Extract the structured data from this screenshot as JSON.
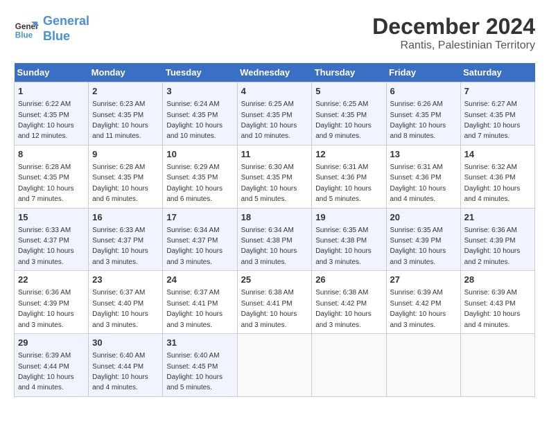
{
  "header": {
    "logo_line1": "General",
    "logo_line2": "Blue",
    "month_year": "December 2024",
    "location": "Rantis, Palestinian Territory"
  },
  "days_of_week": [
    "Sunday",
    "Monday",
    "Tuesday",
    "Wednesday",
    "Thursday",
    "Friday",
    "Saturday"
  ],
  "weeks": [
    [
      {
        "day": "1",
        "info": "Sunrise: 6:22 AM\nSunset: 4:35 PM\nDaylight: 10 hours and 12 minutes."
      },
      {
        "day": "2",
        "info": "Sunrise: 6:23 AM\nSunset: 4:35 PM\nDaylight: 10 hours and 11 minutes."
      },
      {
        "day": "3",
        "info": "Sunrise: 6:24 AM\nSunset: 4:35 PM\nDaylight: 10 hours and 10 minutes."
      },
      {
        "day": "4",
        "info": "Sunrise: 6:25 AM\nSunset: 4:35 PM\nDaylight: 10 hours and 10 minutes."
      },
      {
        "day": "5",
        "info": "Sunrise: 6:25 AM\nSunset: 4:35 PM\nDaylight: 10 hours and 9 minutes."
      },
      {
        "day": "6",
        "info": "Sunrise: 6:26 AM\nSunset: 4:35 PM\nDaylight: 10 hours and 8 minutes."
      },
      {
        "day": "7",
        "info": "Sunrise: 6:27 AM\nSunset: 4:35 PM\nDaylight: 10 hours and 7 minutes."
      }
    ],
    [
      {
        "day": "8",
        "info": "Sunrise: 6:28 AM\nSunset: 4:35 PM\nDaylight: 10 hours and 7 minutes."
      },
      {
        "day": "9",
        "info": "Sunrise: 6:28 AM\nSunset: 4:35 PM\nDaylight: 10 hours and 6 minutes."
      },
      {
        "day": "10",
        "info": "Sunrise: 6:29 AM\nSunset: 4:35 PM\nDaylight: 10 hours and 6 minutes."
      },
      {
        "day": "11",
        "info": "Sunrise: 6:30 AM\nSunset: 4:35 PM\nDaylight: 10 hours and 5 minutes."
      },
      {
        "day": "12",
        "info": "Sunrise: 6:31 AM\nSunset: 4:36 PM\nDaylight: 10 hours and 5 minutes."
      },
      {
        "day": "13",
        "info": "Sunrise: 6:31 AM\nSunset: 4:36 PM\nDaylight: 10 hours and 4 minutes."
      },
      {
        "day": "14",
        "info": "Sunrise: 6:32 AM\nSunset: 4:36 PM\nDaylight: 10 hours and 4 minutes."
      }
    ],
    [
      {
        "day": "15",
        "info": "Sunrise: 6:33 AM\nSunset: 4:37 PM\nDaylight: 10 hours and 3 minutes."
      },
      {
        "day": "16",
        "info": "Sunrise: 6:33 AM\nSunset: 4:37 PM\nDaylight: 10 hours and 3 minutes."
      },
      {
        "day": "17",
        "info": "Sunrise: 6:34 AM\nSunset: 4:37 PM\nDaylight: 10 hours and 3 minutes."
      },
      {
        "day": "18",
        "info": "Sunrise: 6:34 AM\nSunset: 4:38 PM\nDaylight: 10 hours and 3 minutes."
      },
      {
        "day": "19",
        "info": "Sunrise: 6:35 AM\nSunset: 4:38 PM\nDaylight: 10 hours and 3 minutes."
      },
      {
        "day": "20",
        "info": "Sunrise: 6:35 AM\nSunset: 4:39 PM\nDaylight: 10 hours and 3 minutes."
      },
      {
        "day": "21",
        "info": "Sunrise: 6:36 AM\nSunset: 4:39 PM\nDaylight: 10 hours and 2 minutes."
      }
    ],
    [
      {
        "day": "22",
        "info": "Sunrise: 6:36 AM\nSunset: 4:39 PM\nDaylight: 10 hours and 3 minutes."
      },
      {
        "day": "23",
        "info": "Sunrise: 6:37 AM\nSunset: 4:40 PM\nDaylight: 10 hours and 3 minutes."
      },
      {
        "day": "24",
        "info": "Sunrise: 6:37 AM\nSunset: 4:41 PM\nDaylight: 10 hours and 3 minutes."
      },
      {
        "day": "25",
        "info": "Sunrise: 6:38 AM\nSunset: 4:41 PM\nDaylight: 10 hours and 3 minutes."
      },
      {
        "day": "26",
        "info": "Sunrise: 6:38 AM\nSunset: 4:42 PM\nDaylight: 10 hours and 3 minutes."
      },
      {
        "day": "27",
        "info": "Sunrise: 6:39 AM\nSunset: 4:42 PM\nDaylight: 10 hours and 3 minutes."
      },
      {
        "day": "28",
        "info": "Sunrise: 6:39 AM\nSunset: 4:43 PM\nDaylight: 10 hours and 4 minutes."
      }
    ],
    [
      {
        "day": "29",
        "info": "Sunrise: 6:39 AM\nSunset: 4:44 PM\nDaylight: 10 hours and 4 minutes."
      },
      {
        "day": "30",
        "info": "Sunrise: 6:40 AM\nSunset: 4:44 PM\nDaylight: 10 hours and 4 minutes."
      },
      {
        "day": "31",
        "info": "Sunrise: 6:40 AM\nSunset: 4:45 PM\nDaylight: 10 hours and 5 minutes."
      },
      {
        "day": "",
        "info": ""
      },
      {
        "day": "",
        "info": ""
      },
      {
        "day": "",
        "info": ""
      },
      {
        "day": "",
        "info": ""
      }
    ]
  ]
}
